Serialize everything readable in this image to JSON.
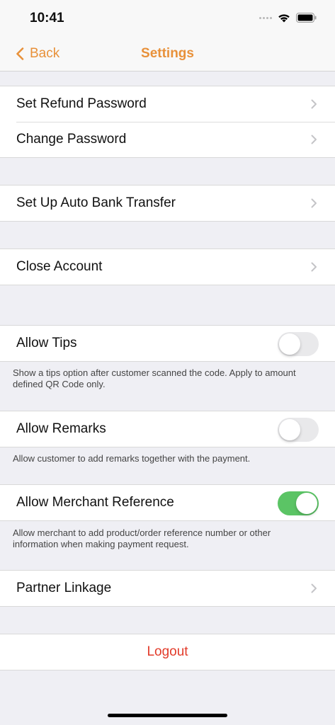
{
  "status_bar": {
    "time": "10:41"
  },
  "nav": {
    "back_label": "Back",
    "title": "Settings"
  },
  "account_group": {
    "set_refund_password": "Set Refund Password",
    "change_password": "Change Password"
  },
  "bank_group": {
    "auto_bank_transfer": "Set Up Auto Bank Transfer"
  },
  "close_group": {
    "close_account": "Close Account"
  },
  "tips": {
    "label": "Allow Tips",
    "enabled": false,
    "note": "Show a tips option after customer scanned the code. Apply to amount defined QR Code only."
  },
  "remarks": {
    "label": "Allow Remarks",
    "enabled": false,
    "note": "Allow customer to add remarks together with the payment."
  },
  "merchant_reference": {
    "label": "Allow Merchant Reference",
    "enabled": true,
    "note": "Allow merchant to add product/order reference number or other information when making payment request."
  },
  "partner_group": {
    "partner_linkage": "Partner Linkage"
  },
  "logout": {
    "label": "Logout"
  },
  "colors": {
    "accent": "#e8913a",
    "toggle_on": "#5bc465",
    "destructive": "#e23b2a"
  }
}
